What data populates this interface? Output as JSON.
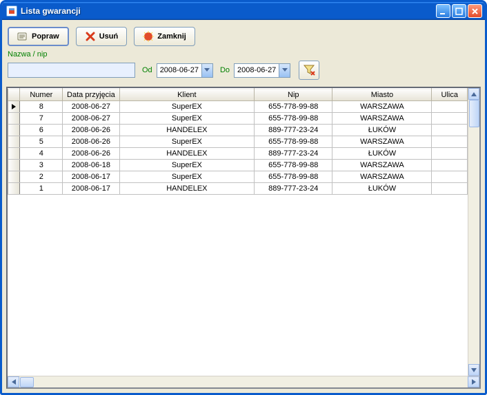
{
  "window": {
    "title": "Lista gwarancji"
  },
  "toolbar": {
    "popraw_label": "Popraw",
    "usun_label": "Usuń",
    "zamknij_label": "Zamknij"
  },
  "filter": {
    "name_label": "Nazwa / nip",
    "name_value": "",
    "od_label": "Od",
    "od_value": "2008-06-27",
    "do_label": "Do",
    "do_value": "2008-06-27"
  },
  "grid": {
    "columns": [
      "Numer",
      "Data przyjęcia",
      "Klient",
      "Nip",
      "Miasto",
      "Ulica"
    ],
    "rows": [
      {
        "numer": "8",
        "data": "2008-06-27",
        "klient": "SuperEX",
        "nip": "655-778-99-88",
        "miasto": "WARSZAWA",
        "ulica": ""
      },
      {
        "numer": "7",
        "data": "2008-06-27",
        "klient": "SuperEX",
        "nip": "655-778-99-88",
        "miasto": "WARSZAWA",
        "ulica": ""
      },
      {
        "numer": "6",
        "data": "2008-06-26",
        "klient": "HANDELEX",
        "nip": "889-777-23-24",
        "miasto": "ŁUKÓW",
        "ulica": ""
      },
      {
        "numer": "5",
        "data": "2008-06-26",
        "klient": "SuperEX",
        "nip": "655-778-99-88",
        "miasto": "WARSZAWA",
        "ulica": ""
      },
      {
        "numer": "4",
        "data": "2008-06-26",
        "klient": "HANDELEX",
        "nip": "889-777-23-24",
        "miasto": "ŁUKÓW",
        "ulica": ""
      },
      {
        "numer": "3",
        "data": "2008-06-18",
        "klient": "SuperEX",
        "nip": "655-778-99-88",
        "miasto": "WARSZAWA",
        "ulica": ""
      },
      {
        "numer": "2",
        "data": "2008-06-17",
        "klient": "SuperEX",
        "nip": "655-778-99-88",
        "miasto": "WARSZAWA",
        "ulica": ""
      },
      {
        "numer": "1",
        "data": "2008-06-17",
        "klient": "HANDELEX",
        "nip": "889-777-23-24",
        "miasto": "ŁUKÓW",
        "ulica": ""
      }
    ]
  }
}
